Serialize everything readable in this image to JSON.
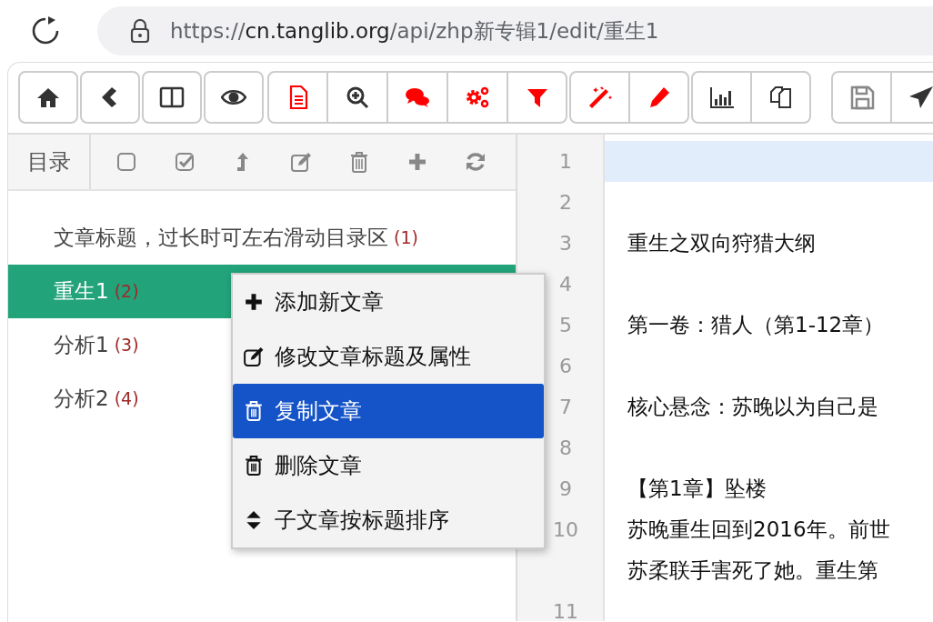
{
  "browser": {
    "url": {
      "scheme": "https://",
      "host": "cn.tanglib.org",
      "path": "/api/zhp新专辑1/edit/重生1"
    }
  },
  "toolbar": {
    "groups": [
      {
        "buttons": [
          {
            "color": "#333333"
          },
          {
            "color": "#333333"
          },
          {
            "color": "#333333"
          },
          {
            "color": "#333333"
          }
        ]
      },
      {
        "buttons": [
          {
            "color": "#ff0000"
          },
          {
            "color": "#333333"
          },
          {
            "color": "#ff0000"
          },
          {
            "color": "#ff0000"
          },
          {
            "color": "#ff0000"
          }
        ]
      },
      {
        "buttons": [
          {
            "color": "#ff0000"
          },
          {
            "color": "#ff0000"
          }
        ]
      },
      {
        "buttons": [
          {
            "color": "#333333"
          },
          {
            "color": "#333333"
          }
        ]
      },
      {
        "buttons": [
          {
            "color": "#888888"
          },
          {
            "color": "#333333"
          }
        ]
      }
    ]
  },
  "sidebar": {
    "title": "目录",
    "items": [
      {
        "title": "文章标题，过长时可左右滑动目录区",
        "count": "(1)",
        "selected": false
      },
      {
        "title": "重生1",
        "count": "(2)",
        "selected": true
      },
      {
        "title": "分析1",
        "count": "(3)",
        "selected": false
      },
      {
        "title": "分析2",
        "count": "(4)",
        "selected": false
      }
    ]
  },
  "context_menu": {
    "items": [
      {
        "label": "添加新文章",
        "selected": false
      },
      {
        "label": "修改文章标题及属性",
        "selected": false
      },
      {
        "label": "复制文章",
        "selected": true
      },
      {
        "label": "删除文章",
        "selected": false
      },
      {
        "label": "子文章按标题排序",
        "selected": false
      }
    ]
  },
  "editor": {
    "lines": [
      {
        "number": "1",
        "current": true
      },
      {
        "number": "2",
        "current": false
      },
      {
        "number": "3",
        "current": false,
        "rows": [
          "重生之双向狩猎大纲"
        ]
      },
      {
        "number": "4",
        "current": false
      },
      {
        "number": "5",
        "current": false,
        "rows": [
          "第一卷：猎人（第1-12章）"
        ]
      },
      {
        "number": "6",
        "current": false
      },
      {
        "number": "7",
        "current": false,
        "rows": [
          "核心悬念：苏晚以为自己是"
        ]
      },
      {
        "number": "8",
        "current": false
      },
      {
        "number": "9",
        "current": false,
        "rows": [
          "【第1章】坠楼"
        ]
      },
      {
        "number": "10",
        "current": false,
        "rows": [
          "苏晚重生回到2016年。前世",
          "苏柔联手害死了她。重生第"
        ]
      },
      {
        "number": "11",
        "current": false
      }
    ]
  }
}
